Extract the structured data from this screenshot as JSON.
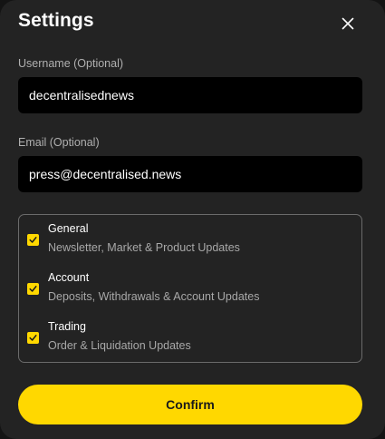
{
  "dialog": {
    "title": "Settings",
    "close_icon": "close-icon"
  },
  "username": {
    "label": "Username (Optional)",
    "value": "decentralisednews"
  },
  "email": {
    "label": "Email (Optional)",
    "value": "press@decentralised.news"
  },
  "preferences": {
    "items": [
      {
        "title": "General",
        "description": "Newsletter, Market & Product Updates",
        "checked": true
      },
      {
        "title": "Account",
        "description": "Deposits, Withdrawals & Account Updates",
        "checked": true
      },
      {
        "title": "Trading",
        "description": "Order & Liquidation Updates",
        "checked": true
      }
    ]
  },
  "confirm": {
    "label": "Confirm"
  },
  "colors": {
    "accent": "#ffd800",
    "background": "#232323",
    "input_background": "#000000"
  }
}
